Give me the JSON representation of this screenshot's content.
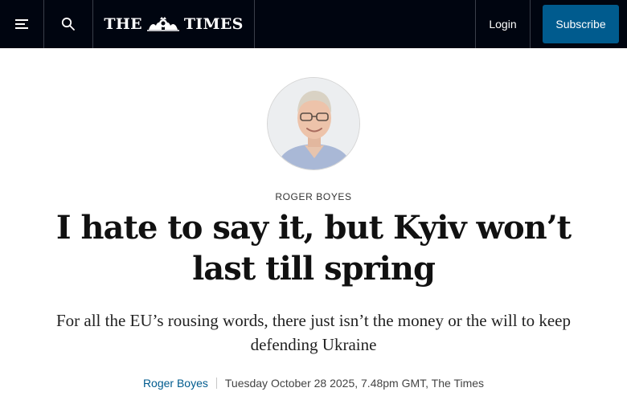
{
  "header": {
    "menu_icon": "hamburger-menu-icon",
    "search_icon": "search-icon",
    "logo_left": "THE",
    "logo_right": "TIMES",
    "login_label": "Login",
    "subscribe_label": "Subscribe",
    "background_color": "#000510",
    "subscribe_color": "#005b8e"
  },
  "article": {
    "author_kicker": "ROGER BOYES",
    "headline": "I hate to say it, but Kyiv won’t last till spring",
    "standfirst": "For all the EU’s rousing words, there just isn’t the money or the will to keep defending Ukraine",
    "byline": {
      "author": "Roger Boyes",
      "meta": "Tuesday October 28 2025, 7.48pm GMT, The Times"
    },
    "accent_color": "#005b8e"
  }
}
